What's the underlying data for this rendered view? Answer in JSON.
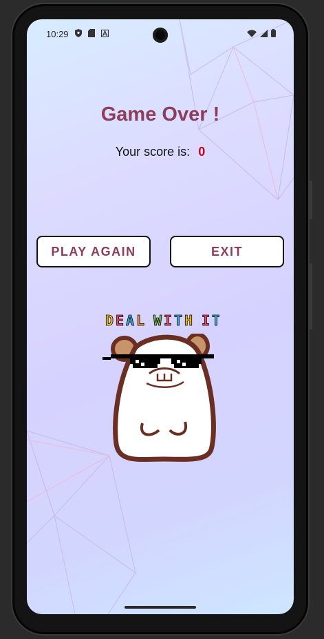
{
  "status_bar": {
    "time": "10:29",
    "left_icons": [
      "shield-icon",
      "sd-card-icon",
      "a-icon"
    ],
    "right_icons": [
      "wifi-icon",
      "signal-icon",
      "battery-icon"
    ]
  },
  "game_over": {
    "title": "Game Over !",
    "score_label": "Your score is:",
    "score_value": "0"
  },
  "buttons": {
    "play_again": "PLAY AGAIN",
    "exit": "EXIT"
  },
  "meme": {
    "caption_letters": [
      "D",
      "E",
      "A",
      "L",
      " ",
      "W",
      "I",
      "T",
      "H",
      " ",
      "I",
      "T"
    ],
    "caption_colors": [
      "#f5c518",
      "#e84a5f",
      "#3fa7d6",
      "#f28c28",
      "#ffffff",
      "#7cc242",
      "#e84a5f",
      "#3fa7d6",
      "#f5c518",
      "#ffffff",
      "#e84a5f",
      "#3fa7d6"
    ],
    "character_icon": "hamster-with-sunglasses-icon"
  },
  "colors": {
    "accent": "#8e3c5c",
    "score": "#d0021b"
  }
}
